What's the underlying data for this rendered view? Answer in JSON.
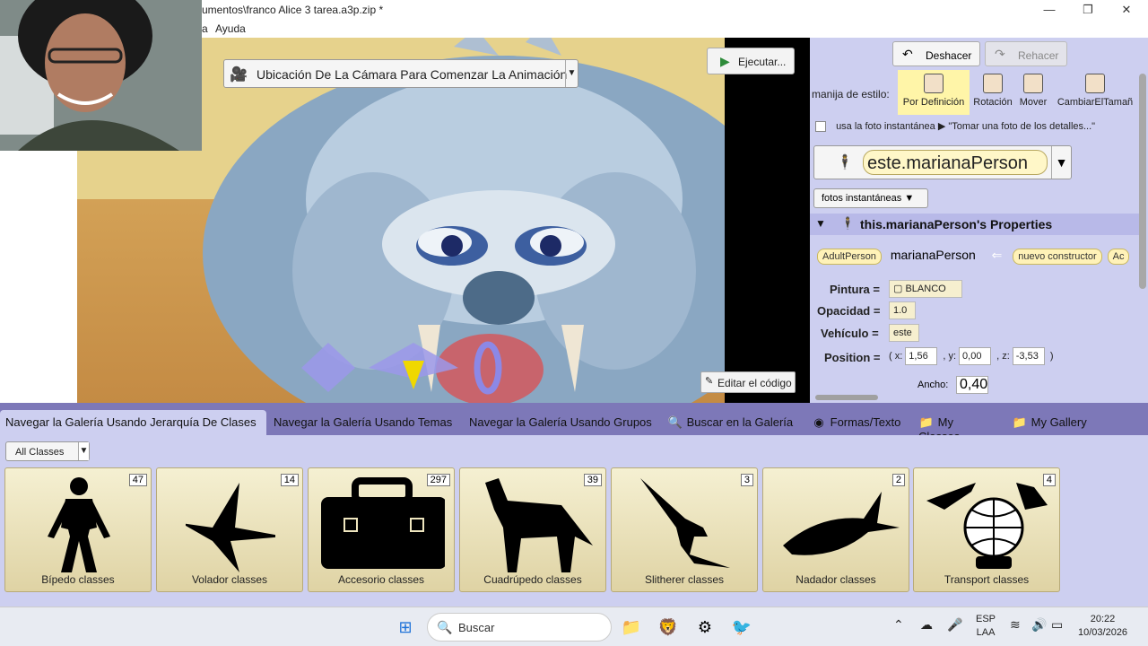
{
  "window": {
    "title": "umentos\\franco Alice 3 tarea.a3p.zip *",
    "menus": [
      "a",
      "Ayuda"
    ],
    "controls": {
      "minimize": "—",
      "maximize": "❐",
      "close": "✕"
    }
  },
  "scene": {
    "camera_marker": "Ubicación De La Cámara Para Comenzar La Animación",
    "run_label": "Ejecutar...",
    "edit_code_label": "Editar el código"
  },
  "panel": {
    "undo_label": "Deshacer",
    "redo_label": "Rehacer",
    "style_label": "manija de estilo:",
    "style_options": [
      "Por Definición",
      "Rotación",
      "Mover",
      "CambiarElTamañ"
    ],
    "snapshot_label": "usa la foto instantánea",
    "snapshot_hint": "\"Tomar una foto de los detalles...\"",
    "selected_object": "este.marianaPerson",
    "snapshots_button": "fotos instantáneas",
    "properties_title": "this.marianaPerson's Properties",
    "class_chip": "AdultPerson",
    "object_name": "marianaPerson",
    "constructor_chip": "nuevo constructor",
    "constructor_chip_tail": "Ac",
    "props": {
      "paint_label": "Pintura =",
      "paint_value": "BLANCO",
      "opacity_label": "Opacidad =",
      "opacity_value": "1.0",
      "vehicle_label": "Vehículo =",
      "vehicle_value": "este",
      "position_label": "Position =",
      "pos_x_label": "x:",
      "pos_x": "1,56",
      "pos_y_label": "y:",
      "pos_y": "0,00",
      "pos_z_label": "z:",
      "pos_z": "-3,53",
      "width_label": "Ancho:",
      "width_value": "0,40"
    }
  },
  "gallery": {
    "tabs": [
      "Navegar la Galería Usando Jerarquía De Clases",
      "Navegar la Galería Usando Temas",
      "Navegar la Galería Usando Grupos",
      "Buscar en la Galería",
      "Formas/Texto",
      "My Classes",
      "My Gallery"
    ],
    "filter": "All Classes",
    "cards": [
      {
        "label": "Bípedo classes",
        "count": "47"
      },
      {
        "label": "Volador classes",
        "count": "14"
      },
      {
        "label": "Accesorio classes",
        "count": "297"
      },
      {
        "label": "Cuadrúpedo classes",
        "count": "39"
      },
      {
        "label": "Slitherer classes",
        "count": "3"
      },
      {
        "label": "Nadador classes",
        "count": "2"
      },
      {
        "label": "Transport classes",
        "count": "4"
      }
    ]
  },
  "taskbar": {
    "search_label": "Buscar",
    "lang_top": "ESP",
    "lang_bottom": "LAA",
    "time": "20:22",
    "date": "10/03/2026"
  },
  "colors": {
    "panel_bg": "#cdcff0",
    "tab_strip": "#7d78b8",
    "card_bg": "#efe6bf",
    "chip_bg": "#fff2b8"
  }
}
